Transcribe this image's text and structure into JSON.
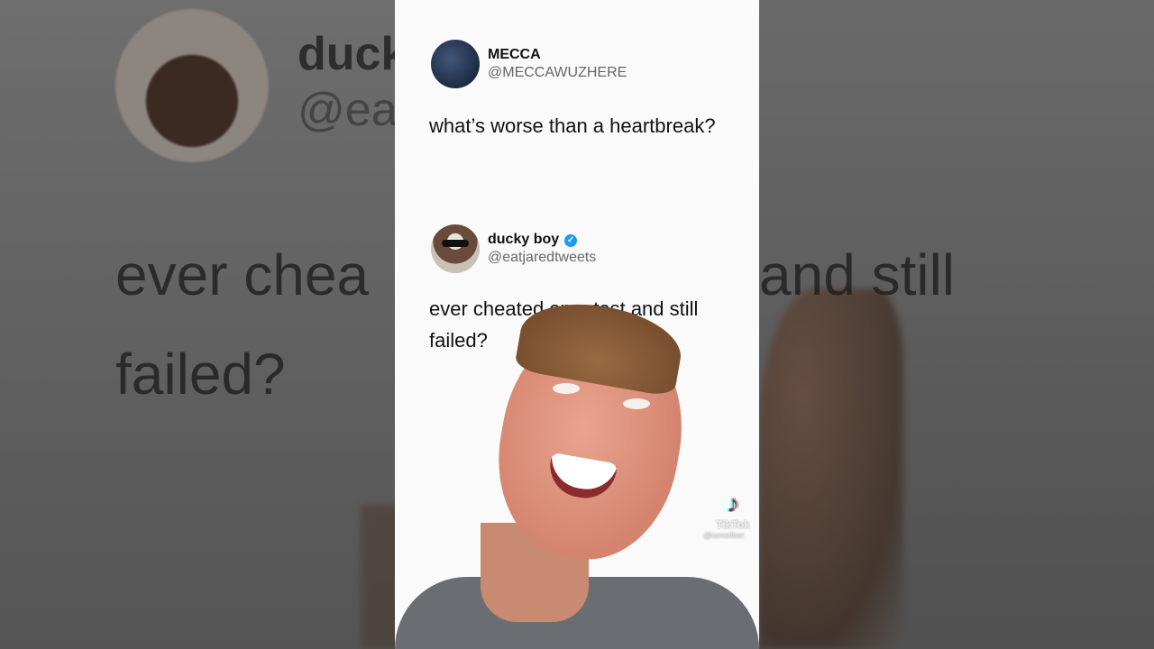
{
  "background": {
    "left_name": "duck",
    "left_handle": "@eat",
    "left_line1": "ever chea",
    "left_line2": "failed?",
    "right_line1": "and still"
  },
  "tweet1": {
    "name": "MECCA",
    "handle": "@MECCAWUZHERE",
    "text": "what’s worse than a heartbreak?"
  },
  "tweet2": {
    "name": "ducky boy",
    "handle": "@eatjaredtweets",
    "text": "ever cheated on a test and still failed?",
    "verified": true
  },
  "watermark": {
    "label": "TikTok",
    "user": "@iamsilber",
    "icon": "tiktok-icon"
  },
  "colors": {
    "verified": "#1d9bf0",
    "column_bg": "#fafafa"
  }
}
